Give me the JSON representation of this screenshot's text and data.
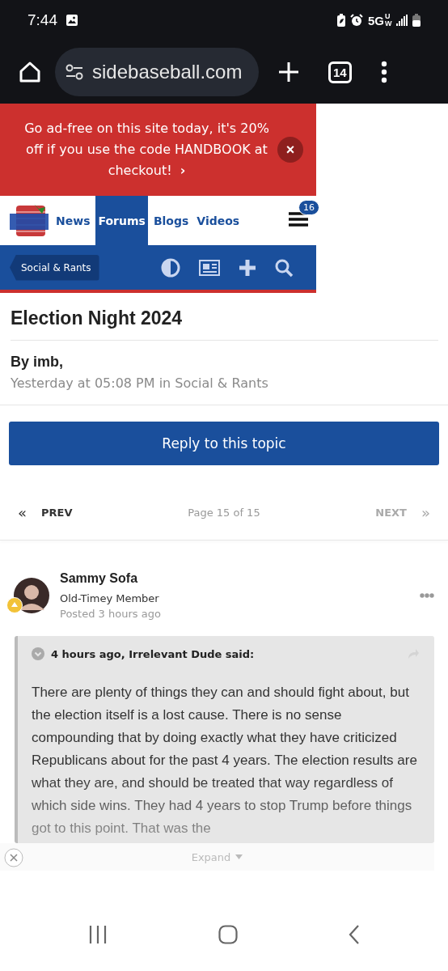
{
  "status_bar": {
    "time": "7:44",
    "network": "5G",
    "network_sub": "UW"
  },
  "browser": {
    "url": "sidebaseball.com",
    "tab_count": "14"
  },
  "promo": {
    "text": "Go ad-free on this site today, it's 20% off if you use the code HANDBOOK at checkout!",
    "arrow": "›",
    "close": "×"
  },
  "site_nav": {
    "items": [
      {
        "label": "News",
        "selected": false
      },
      {
        "label": "Forums",
        "selected": true
      },
      {
        "label": "Blogs",
        "selected": false
      },
      {
        "label": "Videos",
        "selected": false
      }
    ],
    "menu_badge": "16"
  },
  "breadcrumb": "Social & Rants",
  "topic": {
    "title": "Election Night 2024",
    "author": "By imb,",
    "meta": "Yesterday at 05:08 PM in Social & Rants"
  },
  "reply_button": "Reply to this topic",
  "pagination": {
    "prev_arrow": "«",
    "prev": "PREV",
    "prev_disabled": false,
    "page": "Page 15 of 15",
    "next": "NEXT",
    "next_disabled": true,
    "next_arrow": "»"
  },
  "post": {
    "author": "Sammy Sofa",
    "rank": "Old-Timey Member",
    "time": "Posted 3 hours ago",
    "quote": {
      "header": "4 hours ago, Irrelevant Dude said:",
      "text": "There are plenty of things they can and should fight about, but the election itself is a lost cause.  There is no sense compounding that by doing exactly what they have criticized Republicans about for the past 4 years.  The election results are what they are, and should be treated that way regardless of which side wins.  They had 4 years to stop Trump before things got to this point.  That was the",
      "expand": "Expand"
    }
  }
}
